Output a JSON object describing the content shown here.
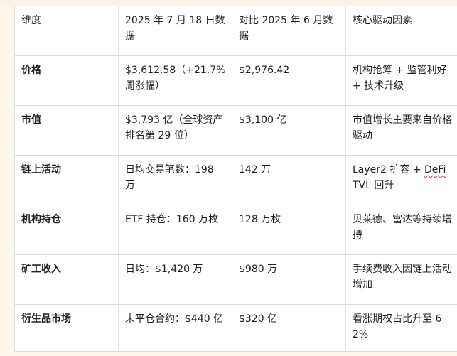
{
  "table": {
    "headers": [
      "维度",
      "2025 年 7 月 18 日数据",
      "对比 2025 年 6 月数据",
      "核心驱动因素"
    ],
    "rows": [
      {
        "label": "价格",
        "current": "$3,612.58（+21.7% 周涨幅）",
        "previous": "$2,976.42",
        "driver": "机构抢筹 + 监管利好 + 技术升级"
      },
      {
        "label": "市值",
        "current": "$3,793 亿（全球资产排名第 29 位）",
        "previous": "$3,100 亿",
        "driver": "市值增长主要来自价格驱动"
      },
      {
        "label": "链上活动",
        "current": "日均交易笔数：198 万",
        "previous": "142 万",
        "driver_prefix": "Layer2 扩容 + ",
        "driver_flagged": "DeFi",
        "driver_suffix": " TVL 回升"
      },
      {
        "label": "机构持仓",
        "current": "ETF 持仓：160 万枚",
        "previous": "128 万枚",
        "driver": "贝莱德、富达等持续增持"
      },
      {
        "label": "矿工收入",
        "current": "日均：$1,420 万",
        "previous": "$980 万",
        "driver": "手续费收入因链上活动增加"
      },
      {
        "label": "衍生品市场",
        "current": "未平仓合约：$440 亿",
        "previous": "$320 亿",
        "driver": "看涨期权占比升至 62%"
      }
    ]
  }
}
